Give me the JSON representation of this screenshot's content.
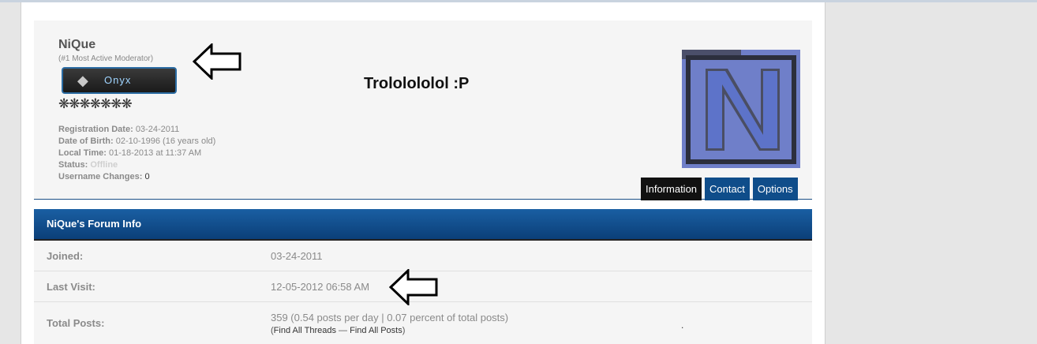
{
  "profile": {
    "username": "NiQue",
    "user_title": "(#1 Most Active Moderator)",
    "rank": {
      "label": "Onyx",
      "icon": "gem-icon"
    },
    "reputation": "❋❋❋❋❋❋❋",
    "status_message": "Trololololol :P",
    "details": {
      "registration_label": "Registration Date:",
      "registration_value": "03-24-2011",
      "dob_label": "Date of Birth:",
      "dob_value": "02-10-1996 (16 years old)",
      "localtime_label": "Local Time:",
      "localtime_value": "01-18-2013 at 11:37 AM",
      "status_label": "Status:",
      "status_value": "Offline",
      "username_changes_label": "Username Changes:",
      "username_changes_value": "0"
    },
    "avatar": {
      "letter": "N",
      "color": "#5d73c9"
    },
    "tabs": [
      {
        "label": "Information",
        "active": true
      },
      {
        "label": "Contact",
        "active": false
      },
      {
        "label": "Options",
        "active": false
      }
    ]
  },
  "forum_info": {
    "title": "NiQue's Forum Info",
    "joined_label": "Joined:",
    "joined_value": "03-24-2011",
    "last_visit_label": "Last Visit:",
    "last_visit_value": "12-05-2012 06:58 AM",
    "total_posts_label": "Total Posts:",
    "total_posts_value": "359 (0.54 posts per day | 0.07 percent of total posts)",
    "open_paren": "(",
    "find_threads": "Find All Threads",
    "sep": " — ",
    "find_posts": "Find All Posts",
    "close_paren": ")",
    "stray_mark": "."
  },
  "annotations": {
    "arrow_icon": "left-arrow-icon"
  },
  "colors": {
    "tab_active": "#111111",
    "tab_inactive": "#0f4d8a",
    "header_blue": "#0b3f78",
    "avatar_blue": "#5d73c9"
  }
}
